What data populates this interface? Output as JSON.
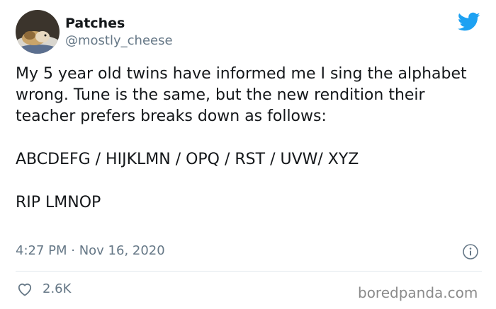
{
  "user": {
    "display_name": "Patches",
    "handle": "@mostly_cheese"
  },
  "tweet": {
    "paragraph_1": "My 5 year old twins have informed me I sing the alphabet wrong. Tune is the same, but the new rendition their teacher prefers breaks down as follows:",
    "paragraph_2": "ABCDEFG / HIJKLMN / OPQ / RST / UVW/ XYZ",
    "paragraph_3": "RIP LMNOP",
    "timestamp": "4:27 PM · Nov 16, 2020"
  },
  "actions": {
    "like_count": "2.6K"
  },
  "watermark": "boredpanda.com",
  "colors": {
    "brand": "#1da1f2",
    "text": "#14171a",
    "muted": "#657786",
    "divider": "#e1e8ed"
  },
  "icons": [
    "twitter-bird-icon",
    "info-icon",
    "heart-icon"
  ]
}
